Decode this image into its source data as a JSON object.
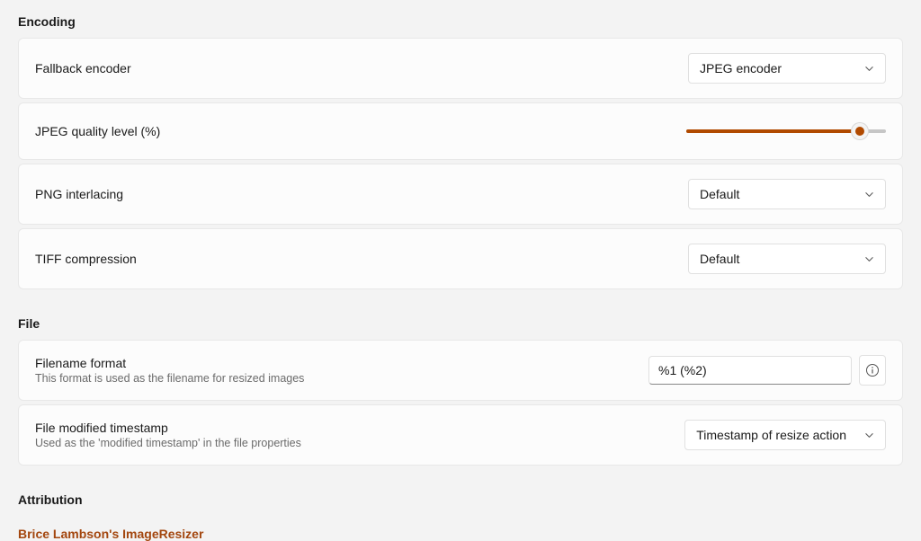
{
  "sections": {
    "encoding": {
      "title": "Encoding"
    },
    "file": {
      "title": "File"
    },
    "attribution": {
      "title": "Attribution"
    }
  },
  "encoding": {
    "fallback": {
      "label": "Fallback encoder",
      "value": "JPEG encoder"
    },
    "jpeg_quality": {
      "label": "JPEG quality level (%)"
    },
    "png_interlacing": {
      "label": "PNG interlacing",
      "value": "Default"
    },
    "tiff_compression": {
      "label": "TIFF compression",
      "value": "Default"
    }
  },
  "file": {
    "filename_format": {
      "label": "Filename format",
      "sub": "This format is used as the filename for resized images",
      "value": "%1 (%2)"
    },
    "modified_timestamp": {
      "label": "File modified timestamp",
      "sub": "Used as the 'modified timestamp' in the file properties",
      "value": "Timestamp of resize action"
    }
  },
  "attribution": {
    "link": "Brice Lambson's ImageResizer"
  }
}
